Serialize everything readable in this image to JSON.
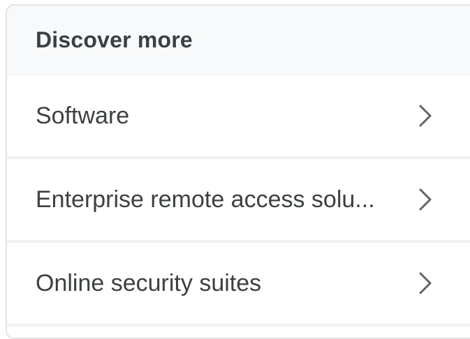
{
  "discover_more": {
    "title": "Discover more",
    "items": [
      {
        "label": "Software",
        "icon": "chevron-right-icon"
      },
      {
        "label": "Enterprise remote access solu...",
        "icon": "chevron-right-icon"
      },
      {
        "label": "Online security suites",
        "icon": "chevron-right-icon"
      }
    ],
    "colors": {
      "header_bg": "#f8f9fa",
      "text": "#3c4043",
      "chevron": "#5f6368",
      "divider": "#f1f3f4"
    }
  }
}
